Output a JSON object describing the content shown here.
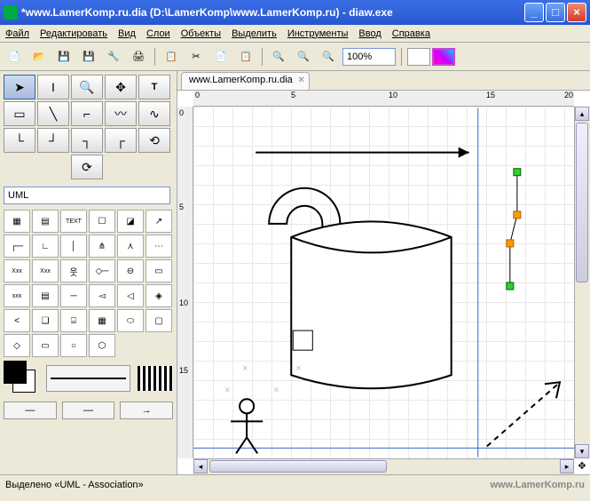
{
  "title": "*www.LamerKomp.ru.dia (D:\\LamerKomp\\www.LamerKomp.ru) - diaw.exe",
  "menu": [
    "Файл",
    "Редактировать",
    "Вид",
    "Слои",
    "Объекты",
    "Выделить",
    "Инструменты",
    "Ввод",
    "Справка"
  ],
  "zoom": "100%",
  "category": "UML",
  "tab": "www.LamerKomp.ru.dia",
  "hruler": [
    "0",
    "5",
    "10",
    "15",
    "20"
  ],
  "vruler": [
    "0",
    "5",
    "10",
    "15"
  ],
  "status": "Выделено «UML - Association»",
  "watermark": "www.LamerKomp.ru",
  "tools": [
    "arrow",
    "text-cursor",
    "zoom",
    "move",
    "text",
    "rect-sel",
    "line",
    "polyline",
    "curve",
    "curve2",
    "elbow1",
    "elbow2",
    "elbow3",
    "elbow4",
    "scroll",
    "image-tool"
  ],
  "shapes": [
    "class",
    "class2",
    "note-txt",
    "small-box",
    "note",
    "msg",
    "life",
    "angle",
    "actor-line",
    "branch",
    "tree",
    "dots-box",
    "xxx1",
    "xxx2",
    "stick",
    "aggreg",
    "circle-bar",
    "obj",
    "xxx3",
    "class3",
    "assoc",
    "hollow-arrow",
    "half-arrow",
    "double-line",
    "half-open",
    "3d-box",
    "cyl",
    "grid",
    "oval",
    "round-rect",
    "diamond",
    "rect-shape",
    "circle",
    "hexagon"
  ],
  "arrow_caps": [
    "none",
    "none",
    "arrow"
  ]
}
